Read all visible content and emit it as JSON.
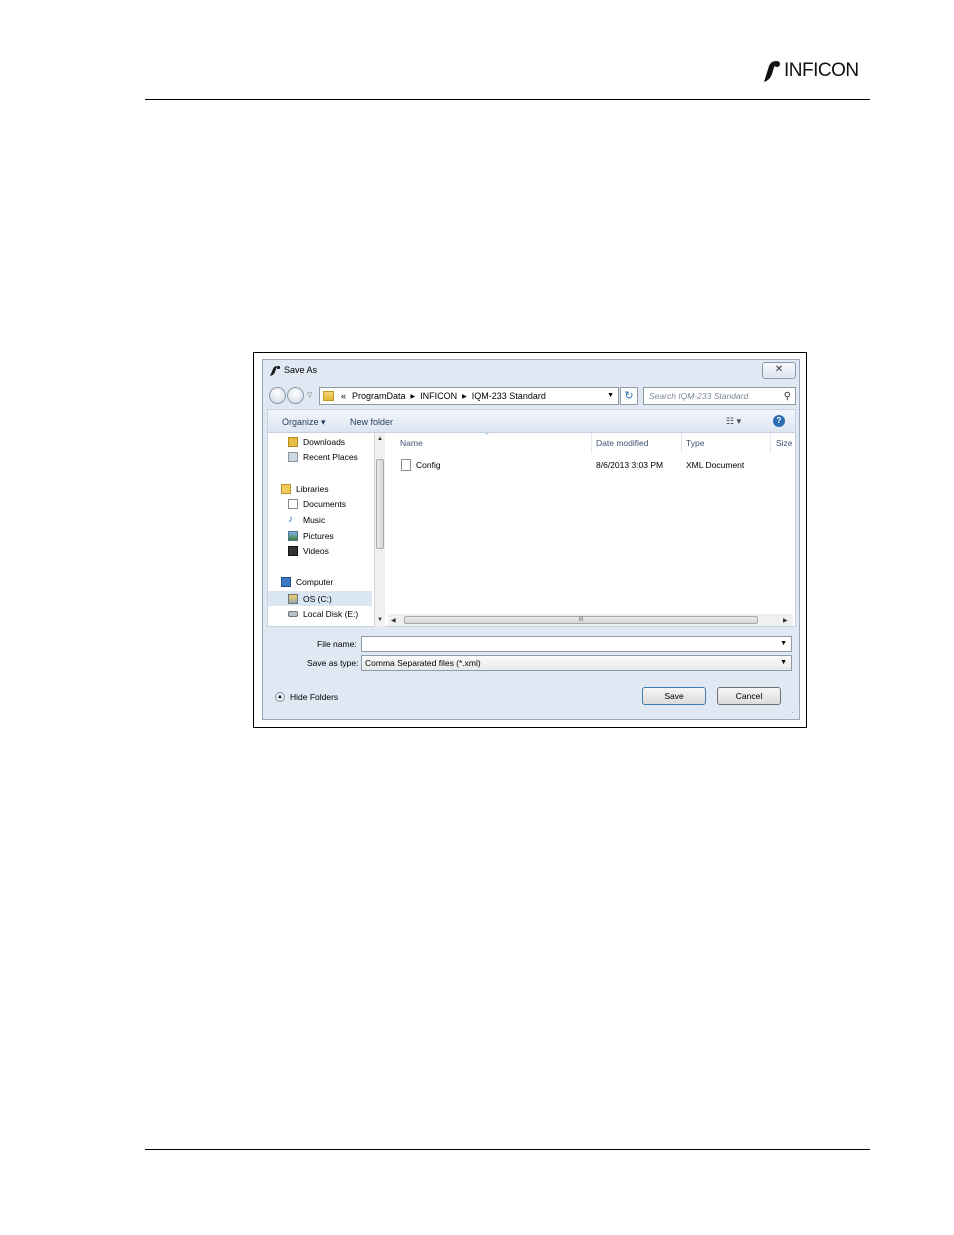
{
  "header": {
    "logo_text": "INFICON"
  },
  "dialog": {
    "title": "Save As",
    "close_label": "✕",
    "address": {
      "overflow": "«",
      "crumbs": [
        "ProgramData",
        "INFICON",
        "IQM-233 Standard"
      ]
    },
    "search_placeholder": "Search IQM-233 Standard",
    "toolbar": {
      "organize": "Organize ▾",
      "new_folder": "New folder"
    },
    "nav": {
      "downloads": "Downloads",
      "recent_places": "Recent Places",
      "libraries": "Libraries",
      "documents": "Documents",
      "music": "Music",
      "pictures": "Pictures",
      "videos": "Videos",
      "computer": "Computer",
      "os_c": "OS (C:)",
      "local_disk_e": "Local Disk (E:)"
    },
    "columns": {
      "name": "Name",
      "date_modified": "Date modified",
      "type": "Type",
      "size": "Size"
    },
    "files": [
      {
        "name": "Config",
        "date_modified": "8/6/2013 3:03 PM",
        "type": "XML Document"
      }
    ],
    "file_name_label": "File name:",
    "file_name_value": "",
    "save_as_type_label": "Save as type:",
    "save_as_type_value": "Comma Separated files (*.xml)",
    "hide_folders": "Hide Folders",
    "save_button": "Save",
    "cancel_button": "Cancel"
  }
}
